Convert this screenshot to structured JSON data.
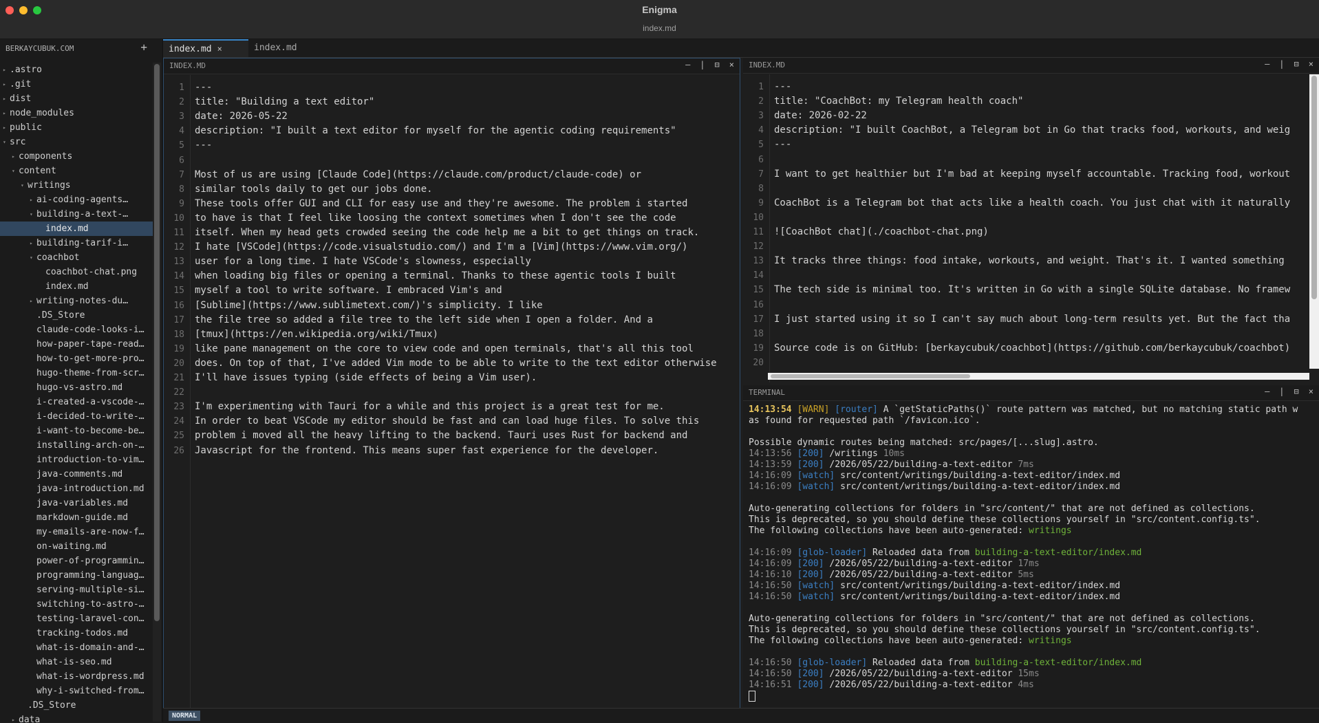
{
  "window": {
    "app_title": "Enigma",
    "file_title": "index.md"
  },
  "sidebar": {
    "header": "BERKAYCUBUK.COM",
    "add_label": "+",
    "items": [
      {
        "label": ".astro",
        "depth": 0,
        "type": "folder",
        "expanded": false
      },
      {
        "label": ".git",
        "depth": 0,
        "type": "folder",
        "expanded": false
      },
      {
        "label": "dist",
        "depth": 0,
        "type": "folder",
        "expanded": false
      },
      {
        "label": "node_modules",
        "depth": 0,
        "type": "folder",
        "expanded": false
      },
      {
        "label": "public",
        "depth": 0,
        "type": "folder",
        "expanded": false
      },
      {
        "label": "src",
        "depth": 0,
        "type": "folder",
        "expanded": true
      },
      {
        "label": "components",
        "depth": 1,
        "type": "folder",
        "expanded": false
      },
      {
        "label": "content",
        "depth": 1,
        "type": "folder",
        "expanded": true
      },
      {
        "label": "writings",
        "depth": 2,
        "type": "folder",
        "expanded": true
      },
      {
        "label": "ai-coding-agents…",
        "depth": 3,
        "type": "folder",
        "expanded": false
      },
      {
        "label": "building-a-text-…",
        "depth": 3,
        "type": "folder",
        "expanded": true
      },
      {
        "label": "index.md",
        "depth": 4,
        "type": "file",
        "selected": true
      },
      {
        "label": "building-tarif-i…",
        "depth": 3,
        "type": "folder",
        "expanded": false
      },
      {
        "label": "coachbot",
        "depth": 3,
        "type": "folder",
        "expanded": true
      },
      {
        "label": "coachbot-chat.png",
        "depth": 4,
        "type": "file"
      },
      {
        "label": "index.md",
        "depth": 4,
        "type": "file"
      },
      {
        "label": "writing-notes-du…",
        "depth": 3,
        "type": "folder",
        "expanded": false
      },
      {
        "label": ".DS_Store",
        "depth": 3,
        "type": "file"
      },
      {
        "label": "claude-code-looks-i…",
        "depth": 3,
        "type": "file"
      },
      {
        "label": "how-paper-tape-read…",
        "depth": 3,
        "type": "file"
      },
      {
        "label": "how-to-get-more-pro…",
        "depth": 3,
        "type": "file"
      },
      {
        "label": "hugo-theme-from-scr…",
        "depth": 3,
        "type": "file"
      },
      {
        "label": "hugo-vs-astro.md",
        "depth": 3,
        "type": "file"
      },
      {
        "label": "i-created-a-vscode-…",
        "depth": 3,
        "type": "file"
      },
      {
        "label": "i-decided-to-write-…",
        "depth": 3,
        "type": "file"
      },
      {
        "label": "i-want-to-become-be…",
        "depth": 3,
        "type": "file"
      },
      {
        "label": "installing-arch-on-…",
        "depth": 3,
        "type": "file"
      },
      {
        "label": "introduction-to-vim…",
        "depth": 3,
        "type": "file"
      },
      {
        "label": "java-comments.md",
        "depth": 3,
        "type": "file"
      },
      {
        "label": "java-introduction.md",
        "depth": 3,
        "type": "file"
      },
      {
        "label": "java-variables.md",
        "depth": 3,
        "type": "file"
      },
      {
        "label": "markdown-guide.md",
        "depth": 3,
        "type": "file"
      },
      {
        "label": "my-emails-are-now-f…",
        "depth": 3,
        "type": "file"
      },
      {
        "label": "on-waiting.md",
        "depth": 3,
        "type": "file"
      },
      {
        "label": "power-of-programmin…",
        "depth": 3,
        "type": "file"
      },
      {
        "label": "programming-languag…",
        "depth": 3,
        "type": "file"
      },
      {
        "label": "serving-multiple-si…",
        "depth": 3,
        "type": "file"
      },
      {
        "label": "switching-to-astro-…",
        "depth": 3,
        "type": "file"
      },
      {
        "label": "testing-laravel-con…",
        "depth": 3,
        "type": "file"
      },
      {
        "label": "tracking-todos.md",
        "depth": 3,
        "type": "file"
      },
      {
        "label": "what-is-domain-and-…",
        "depth": 3,
        "type": "file"
      },
      {
        "label": "what-is-seo.md",
        "depth": 3,
        "type": "file"
      },
      {
        "label": "what-is-wordpress.md",
        "depth": 3,
        "type": "file"
      },
      {
        "label": "why-i-switched-from…",
        "depth": 3,
        "type": "file"
      },
      {
        "label": ".DS_Store",
        "depth": 2,
        "type": "file"
      },
      {
        "label": "data",
        "depth": 1,
        "type": "folder",
        "expanded": false
      }
    ]
  },
  "tabs": [
    {
      "label": "index.md",
      "active": true,
      "close": "×"
    },
    {
      "label": "index.md",
      "active": false
    }
  ],
  "pane_controls": [
    "—",
    "|",
    "⊟",
    "×"
  ],
  "left_pane": {
    "title": "INDEX.MD",
    "lines": [
      "---",
      "title: \"Building a text editor\"",
      "date: 2026-05-22",
      "description: \"I built a text editor for myself for the agentic coding requirements\"",
      "---",
      "",
      "Most of us are using [Claude Code](https://claude.com/product/claude-code) or",
      "similar tools daily to get our jobs done.",
      "These tools offer GUI and CLI for easy use and they're awesome. The problem i started",
      "to have is that I feel like loosing the context sometimes when I don't see the code",
      "itself. When my head gets crowded seeing the code help me a bit to get things on track.",
      "I hate [VSCode](https://code.visualstudio.com/) and I'm a [Vim](https://www.vim.org/)",
      "user for a long time. I hate VSCode's slowness, especially",
      "when loading big files or opening a terminal. Thanks to these agentic tools I built",
      "myself a tool to write software. I embraced Vim's and",
      "[Sublime](https://www.sublimetext.com/)'s simplicity. I like",
      "the file tree so added a file tree to the left side when I open a folder. And a",
      "[tmux](https://en.wikipedia.org/wiki/Tmux)",
      "like pane management on the core to view code and open terminals, that's all this tool",
      "does. On top of that, I've added Vim mode to be able to write to the text editor otherwise",
      "I'll have issues typing (side effects of being a Vim user).",
      "",
      "I'm experimenting with Tauri for a while and this project is a great test for me.",
      "In order to beat VSCode my editor should be fast and can load huge files. To solve this",
      "problem i moved all the heavy lifting to the backend. Tauri uses Rust for backend and",
      "Javascript for the frontend. This means super fast experience for the developer."
    ]
  },
  "right_pane": {
    "title": "INDEX.MD",
    "lines": [
      "---",
      "title: \"CoachBot: my Telegram health coach\"",
      "date: 2026-02-22",
      "description: \"I built CoachBot, a Telegram bot in Go that tracks food, workouts, and weig",
      "---",
      "",
      "I want to get healthier but I'm bad at keeping myself accountable. Tracking food, workout",
      "",
      "CoachBot is a Telegram bot that acts like a health coach. You just chat with it naturally",
      "",
      "![CoachBot chat](./coachbot-chat.png)",
      "",
      "It tracks three things: food intake, workouts, and weight. That's it. I wanted something",
      "",
      "The tech side is minimal too. It's written in Go with a single SQLite database. No framew",
      "",
      "I just started using it so I can't say much about long-term results yet. But the fact tha",
      "",
      "Source code is on GitHub: [berkaycubuk/coachbot](https://github.com/berkaycubuk/coachbot)",
      ""
    ]
  },
  "terminal": {
    "title": "TERMINAL",
    "lines": [
      [
        {
          "t": "14:13:54",
          "c": "ts-hl"
        },
        {
          "t": " "
        },
        {
          "t": "[WARN]",
          "c": "warn"
        },
        {
          "t": " "
        },
        {
          "t": "[router]",
          "c": "tag"
        },
        {
          "t": " A `getStaticPaths()` route pattern was matched, but no matching static path w"
        }
      ],
      [
        {
          "t": "as found for requested path `/favicon.ico`."
        }
      ],
      [],
      [
        {
          "t": "Possible dynamic routes being matched: src/pages/[...slug].astro."
        }
      ],
      [
        {
          "t": "14:13:56",
          "c": "ts"
        },
        {
          "t": " "
        },
        {
          "t": "[200]",
          "c": "tag"
        },
        {
          "t": " /writings "
        },
        {
          "t": "10ms",
          "c": "ts"
        }
      ],
      [
        {
          "t": "14:13:59",
          "c": "ts"
        },
        {
          "t": " "
        },
        {
          "t": "[200]",
          "c": "tag"
        },
        {
          "t": " /2026/05/22/building-a-text-editor "
        },
        {
          "t": "7ms",
          "c": "ts"
        }
      ],
      [
        {
          "t": "14:16:09",
          "c": "ts"
        },
        {
          "t": " "
        },
        {
          "t": "[watch]",
          "c": "tag"
        },
        {
          "t": " src/content/writings/building-a-text-editor/index.md"
        }
      ],
      [
        {
          "t": "14:16:09",
          "c": "ts"
        },
        {
          "t": " "
        },
        {
          "t": "[watch]",
          "c": "tag"
        },
        {
          "t": " src/content/writings/building-a-text-editor/index.md"
        }
      ],
      [],
      [
        {
          "t": "Auto-generating collections for folders in \"src/content/\" that are not defined as collections."
        }
      ],
      [
        {
          "t": "This is deprecated, so you should define these collections yourself in \"src/content.config.ts\"."
        }
      ],
      [
        {
          "t": "The following collections have been auto-generated: "
        },
        {
          "t": "writings",
          "c": "green"
        }
      ],
      [],
      [
        {
          "t": "14:16:09",
          "c": "ts"
        },
        {
          "t": " "
        },
        {
          "t": "[glob-loader]",
          "c": "tag"
        },
        {
          "t": " Reloaded data from "
        },
        {
          "t": "building-a-text-editor/index.md",
          "c": "green"
        }
      ],
      [
        {
          "t": "14:16:09",
          "c": "ts"
        },
        {
          "t": " "
        },
        {
          "t": "[200]",
          "c": "tag"
        },
        {
          "t": " /2026/05/22/building-a-text-editor "
        },
        {
          "t": "17ms",
          "c": "ts"
        }
      ],
      [
        {
          "t": "14:16:10",
          "c": "ts"
        },
        {
          "t": " "
        },
        {
          "t": "[200]",
          "c": "tag"
        },
        {
          "t": " /2026/05/22/building-a-text-editor "
        },
        {
          "t": "5ms",
          "c": "ts"
        }
      ],
      [
        {
          "t": "14:16:50",
          "c": "ts"
        },
        {
          "t": " "
        },
        {
          "t": "[watch]",
          "c": "tag"
        },
        {
          "t": " src/content/writings/building-a-text-editor/index.md"
        }
      ],
      [
        {
          "t": "14:16:50",
          "c": "ts"
        },
        {
          "t": " "
        },
        {
          "t": "[watch]",
          "c": "tag"
        },
        {
          "t": " src/content/writings/building-a-text-editor/index.md"
        }
      ],
      [],
      [
        {
          "t": "Auto-generating collections for folders in \"src/content/\" that are not defined as collections."
        }
      ],
      [
        {
          "t": "This is deprecated, so you should define these collections yourself in \"src/content.config.ts\"."
        }
      ],
      [
        {
          "t": "The following collections have been auto-generated: "
        },
        {
          "t": "writings",
          "c": "green"
        }
      ],
      [],
      [
        {
          "t": "14:16:50",
          "c": "ts"
        },
        {
          "t": " "
        },
        {
          "t": "[glob-loader]",
          "c": "tag"
        },
        {
          "t": " Reloaded data from "
        },
        {
          "t": "building-a-text-editor/index.md",
          "c": "green"
        }
      ],
      [
        {
          "t": "14:16:50",
          "c": "ts"
        },
        {
          "t": " "
        },
        {
          "t": "[200]",
          "c": "tag"
        },
        {
          "t": " /2026/05/22/building-a-text-editor "
        },
        {
          "t": "15ms",
          "c": "ts"
        }
      ],
      [
        {
          "t": "14:16:51",
          "c": "ts"
        },
        {
          "t": " "
        },
        {
          "t": "[200]",
          "c": "tag"
        },
        {
          "t": " /2026/05/22/building-a-text-editor "
        },
        {
          "t": "4ms",
          "c": "ts"
        }
      ]
    ]
  },
  "status": {
    "mode": "NORMAL"
  },
  "colors": {
    "accent": "#3a86c8",
    "selection": "#31475f",
    "link_tag": "#3b7fc4",
    "green": "#6fb33a",
    "timestamp_highlight": "#e6c35c"
  }
}
